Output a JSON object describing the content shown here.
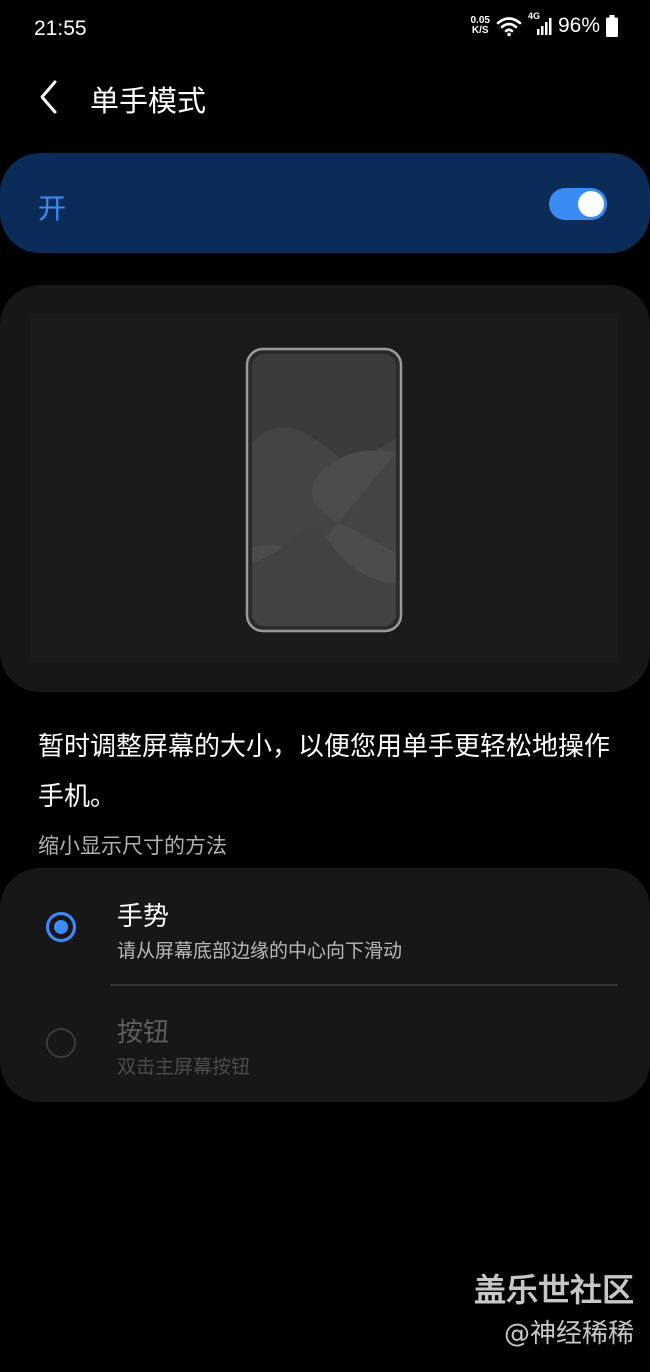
{
  "status_bar": {
    "time": "21:55",
    "net_speed_value": "0.05",
    "net_speed_unit": "K/S",
    "network_type": "4G",
    "battery": "96%",
    "icons": [
      "wifi-icon",
      "cellular-signal-icon",
      "battery-icon"
    ]
  },
  "header": {
    "title": "单手模式",
    "back_icon": "chevron-left-icon"
  },
  "master_toggle": {
    "label": "开",
    "state": "on",
    "accent_color": "#3d8cf7"
  },
  "description": "暂时调整屏幕的大小，以便您用单手更轻松地操作手机。",
  "methods_section": {
    "title": "缩小显示尺寸的方法",
    "options": [
      {
        "title": "手势",
        "subtitle": "请从屏幕底部边缘的中心向下滑动",
        "selected": true
      },
      {
        "title": "按钮",
        "subtitle": "双击主屏幕按钮",
        "selected": false
      }
    ]
  },
  "watermark": {
    "line1": "盖乐世社区",
    "line2": "@神经稀稀"
  }
}
